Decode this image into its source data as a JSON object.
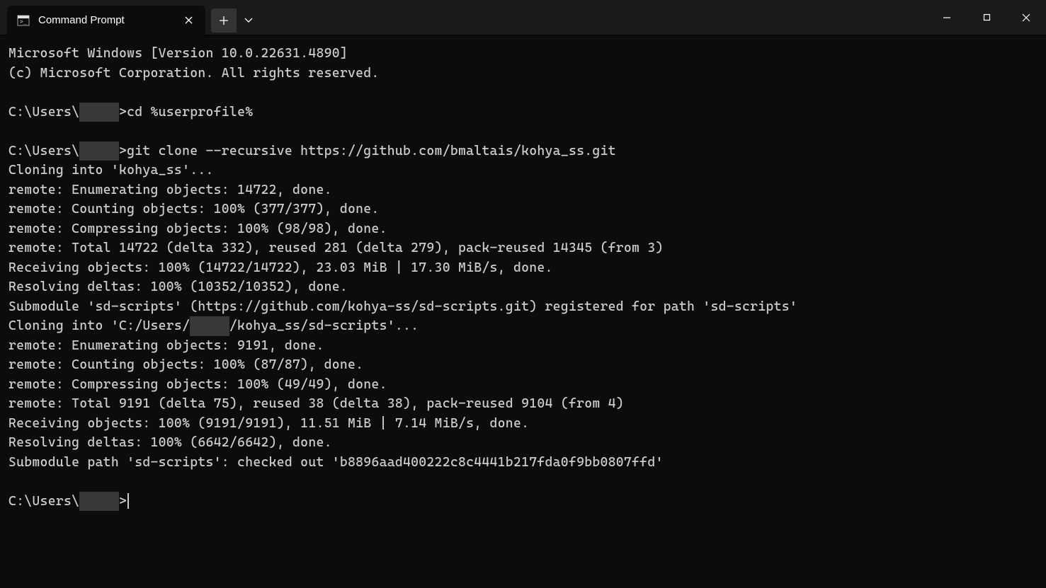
{
  "titlebar": {
    "tab_title": "Command Prompt"
  },
  "terminal": {
    "lines": [
      {
        "type": "text",
        "value": "Microsoft Windows [Version 10.0.22631.4890]"
      },
      {
        "type": "text",
        "value": "(c) Microsoft Corporation. All rights reserved."
      },
      {
        "type": "blank"
      },
      {
        "type": "prompt",
        "prefix": "C:\\Users\\",
        "redacted": "     ",
        "suffix": ">cd %userprofile%"
      },
      {
        "type": "blank"
      },
      {
        "type": "prompt",
        "prefix": "C:\\Users\\",
        "redacted": "     ",
        "suffix": ">git clone --recursive https://github.com/bmaltais/kohya_ss.git"
      },
      {
        "type": "text",
        "value": "Cloning into 'kohya_ss'..."
      },
      {
        "type": "text",
        "value": "remote: Enumerating objects: 14722, done."
      },
      {
        "type": "text",
        "value": "remote: Counting objects: 100% (377/377), done."
      },
      {
        "type": "text",
        "value": "remote: Compressing objects: 100% (98/98), done."
      },
      {
        "type": "text",
        "value": "remote: Total 14722 (delta 332), reused 281 (delta 279), pack-reused 14345 (from 3)"
      },
      {
        "type": "text",
        "value": "Receiving objects: 100% (14722/14722), 23.03 MiB | 17.30 MiB/s, done."
      },
      {
        "type": "text",
        "value": "Resolving deltas: 100% (10352/10352), done."
      },
      {
        "type": "text",
        "value": "Submodule 'sd-scripts' (https://github.com/kohya-ss/sd-scripts.git) registered for path 'sd-scripts'"
      },
      {
        "type": "pathredact",
        "prefix": "Cloning into 'C:/Users/",
        "redacted": "     ",
        "suffix": "/kohya_ss/sd-scripts'..."
      },
      {
        "type": "text",
        "value": "remote: Enumerating objects: 9191, done."
      },
      {
        "type": "text",
        "value": "remote: Counting objects: 100% (87/87), done."
      },
      {
        "type": "text",
        "value": "remote: Compressing objects: 100% (49/49), done."
      },
      {
        "type": "text",
        "value": "remote: Total 9191 (delta 75), reused 38 (delta 38), pack-reused 9104 (from 4)"
      },
      {
        "type": "text",
        "value": "Receiving objects: 100% (9191/9191), 11.51 MiB | 7.14 MiB/s, done."
      },
      {
        "type": "text",
        "value": "Resolving deltas: 100% (6642/6642), done."
      },
      {
        "type": "text",
        "value": "Submodule path 'sd-scripts': checked out 'b8896aad400222c8c4441b217fda0f9bb0807ffd'"
      },
      {
        "type": "blank"
      },
      {
        "type": "prompt-cursor",
        "prefix": "C:\\Users\\",
        "redacted": "     ",
        "suffix": ">"
      }
    ]
  }
}
